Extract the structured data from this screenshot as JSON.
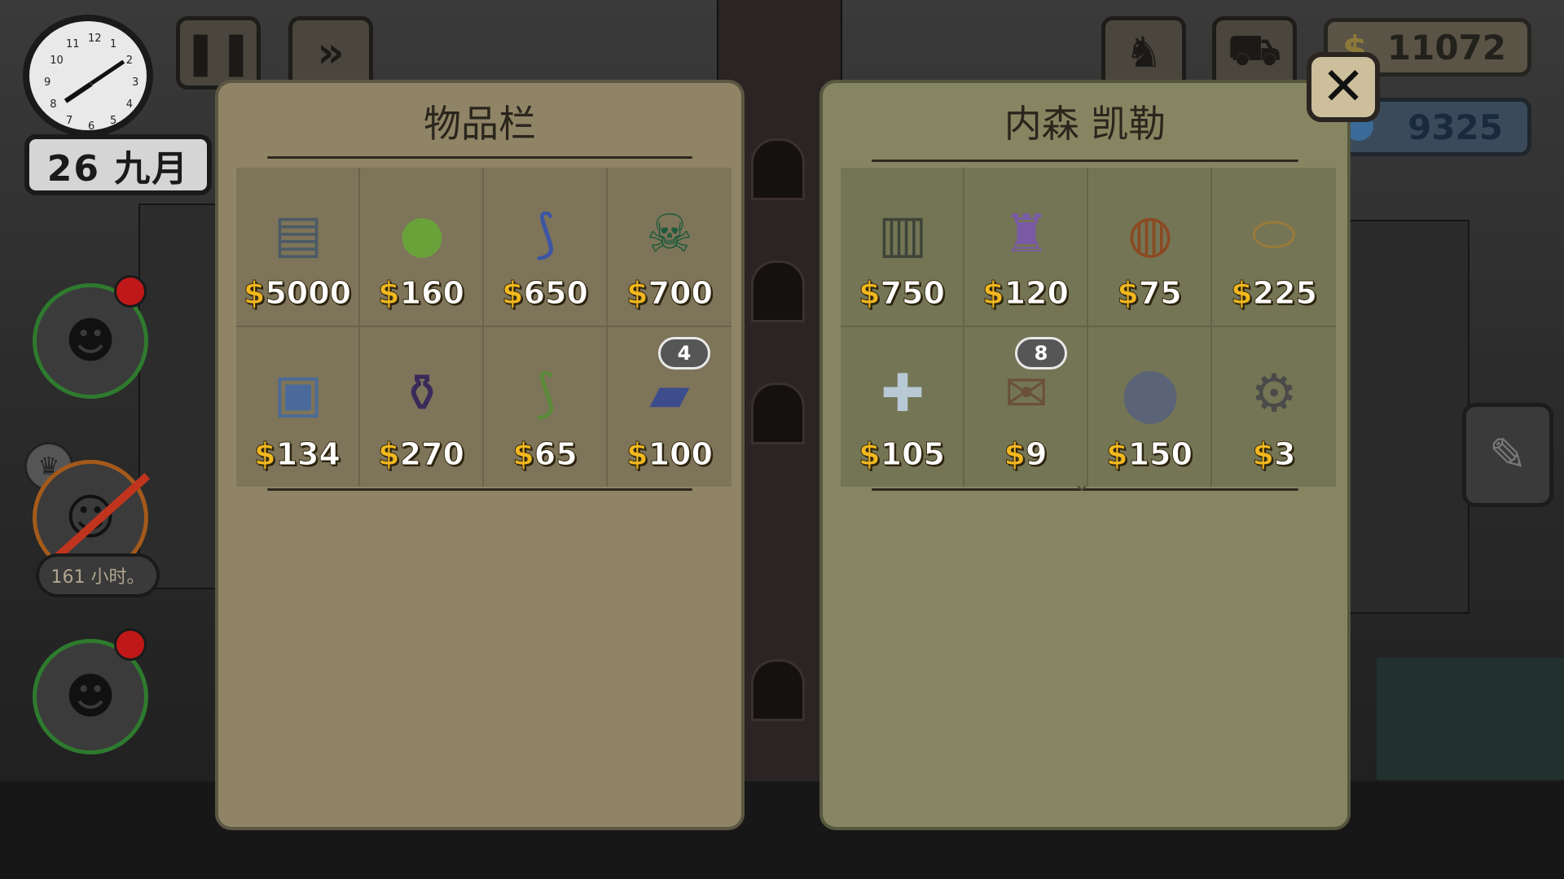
{
  "hud": {
    "date": "26 九月",
    "clock_numbers": [
      "12",
      "1",
      "2",
      "3",
      "4",
      "5",
      "6",
      "7",
      "8",
      "9",
      "10",
      "11"
    ],
    "money": "11072",
    "gems": "9325",
    "tenant_hours": "161 小时。"
  },
  "inventory": {
    "title": "物品栏",
    "items": [
      {
        "icon": "money-bills-icon",
        "glyph": "▤",
        "color": "#4c5a66",
        "price": "5000",
        "count": ""
      },
      {
        "icon": "green-apple-icon",
        "glyph": "●",
        "color": "#6aa23a",
        "price": "160",
        "count": ""
      },
      {
        "icon": "blue-tie-icon",
        "glyph": "⟆",
        "color": "#3c56a4",
        "price": "650",
        "count": ""
      },
      {
        "icon": "poison-bottle-icon",
        "glyph": "☠",
        "color": "#1e5a3a",
        "price": "700",
        "count": ""
      },
      {
        "icon": "ink-bottle-icon",
        "glyph": "▣",
        "color": "#4a6a9c",
        "price": "134",
        "count": ""
      },
      {
        "icon": "moonshine-jug-icon",
        "glyph": "⚱",
        "color": "#3a2a5a",
        "price": "270",
        "count": ""
      },
      {
        "icon": "green-tie-icon",
        "glyph": "⟆",
        "color": "#5a8a3a",
        "price": "65",
        "count": ""
      },
      {
        "icon": "blue-book-icon",
        "glyph": "▰",
        "color": "#3c4c8c",
        "price": "100",
        "count": "4"
      }
    ]
  },
  "shop": {
    "title": "内森 凯勒",
    "items": [
      {
        "icon": "xray-films-icon",
        "glyph": "▥",
        "color": "#3e4438",
        "price": "750",
        "count": ""
      },
      {
        "icon": "purple-shirt-icon",
        "glyph": "♜",
        "color": "#7a5aa4",
        "price": "120",
        "count": ""
      },
      {
        "icon": "roast-chicken-icon",
        "glyph": "◍",
        "color": "#8a4a22",
        "price": "75",
        "count": ""
      },
      {
        "icon": "bow-hat-icon",
        "glyph": "⬭",
        "color": "#9a7a3a",
        "price": "225",
        "count": ""
      },
      {
        "icon": "medical-coat-icon",
        "glyph": "✚",
        "color": "#b8c8d4",
        "price": "105",
        "count": ""
      },
      {
        "icon": "documents-stamp-icon",
        "glyph": "✉",
        "color": "#6a5038",
        "price": "9",
        "count": "8"
      },
      {
        "icon": "kettlebell-icon",
        "glyph": "⬤",
        "color": "#5a6476",
        "price": "150",
        "count": ""
      },
      {
        "icon": "gear-wrench-icon",
        "glyph": "⚙",
        "color": "#4a4a48",
        "price": "3",
        "count": ""
      }
    ]
  },
  "currency_symbol": "$"
}
